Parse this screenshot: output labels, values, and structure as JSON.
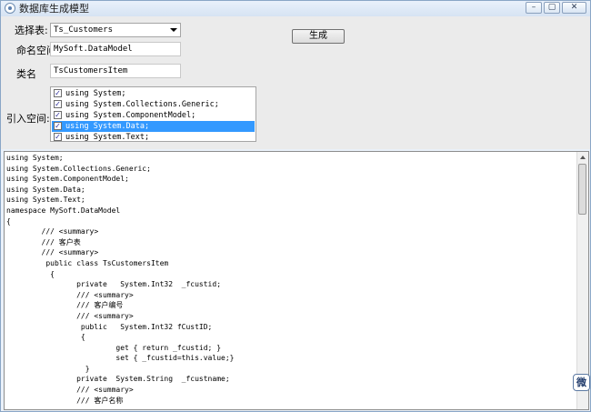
{
  "window": {
    "title": "数据库生成模型",
    "min_glyph": "–",
    "max_glyph": "▢",
    "close_glyph": "✕"
  },
  "form": {
    "table_label": "选择表:",
    "table_value": "Ts_Customers",
    "namespace_label": "命名空间",
    "namespace_value": "MySoft.DataModel",
    "class_label": "类名",
    "class_value": "TsCustomersItem",
    "generate_label": "生成",
    "imports_label": "引入空间:",
    "imports": [
      {
        "text": "using System;",
        "checked": true,
        "check": "✓"
      },
      {
        "text": "using System.Collections.Generic;",
        "checked": true,
        "check": "✓"
      },
      {
        "text": "using System.ComponentModel;",
        "checked": true,
        "check": "✓"
      },
      {
        "text": "using System.Data;",
        "checked": true,
        "check": "✓"
      },
      {
        "text": "using System.Text;",
        "checked": true,
        "check": "✓"
      }
    ],
    "selected_import": "using System.Data;"
  },
  "code_lines": [
    "using System;",
    "using System.Collections.Generic;",
    "using System.ComponentModel;",
    "using System.Data;",
    "using System.Text;",
    "namespace MySoft.DataModel",
    "{",
    "        /// <summary>",
    "        /// 客户表",
    "        /// <summary>",
    "         public class TsCustomersItem",
    "          {",
    "                private   System.Int32  _fcustid;",
    "                /// <summary>",
    "                /// 客户编号",
    "                /// <summary>",
    "                 public   System.Int32 fCustID;",
    "                 {",
    "                         get { return _fcustid; }",
    "                         set { _fcustid=this.value;}",
    "                  }",
    "                private  System.String  _fcustname;",
    "                /// <summary>",
    "                /// 客户名称"
  ],
  "badge": {
    "text": "微"
  }
}
